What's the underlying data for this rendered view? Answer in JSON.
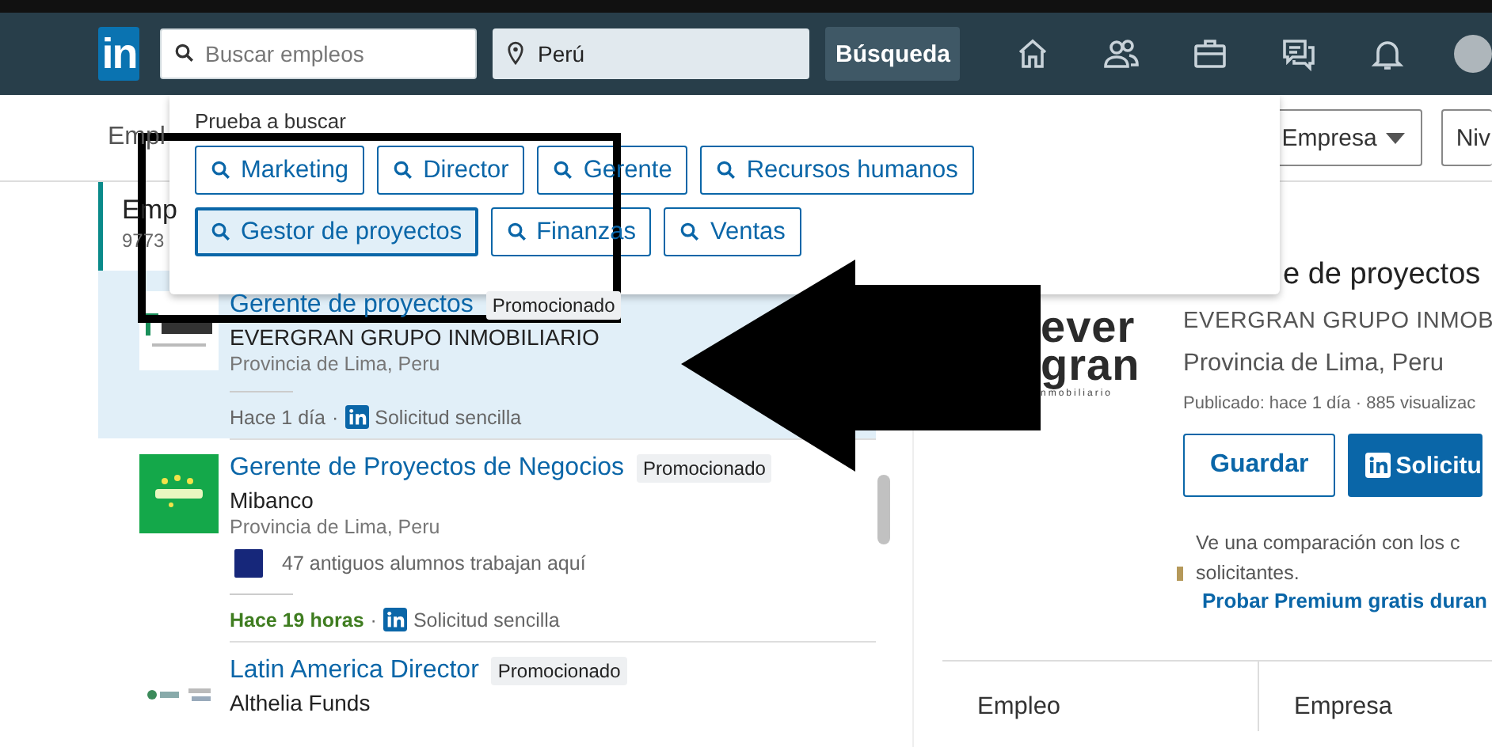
{
  "nav": {
    "logo": "in",
    "search": {
      "placeholder": "Buscar empleos"
    },
    "location": {
      "value": "Perú"
    },
    "search_button": "Búsqueda"
  },
  "filters": {
    "label": "Empl",
    "buttons": [
      {
        "label": "Empresa",
        "dropdown": true
      },
      {
        "label": "Niv",
        "dropdown": false
      }
    ]
  },
  "suggestions": {
    "heading": "Prueba a buscar",
    "chips": [
      {
        "label": "Marketing",
        "selected": false
      },
      {
        "label": "Director",
        "selected": false
      },
      {
        "label": "Gerente",
        "selected": false
      },
      {
        "label": "Recursos humanos",
        "selected": false
      },
      {
        "label": "Gestor de proyectos",
        "selected": true
      },
      {
        "label": "Finanzas",
        "selected": false
      },
      {
        "label": "Ventas",
        "selected": false
      }
    ]
  },
  "results": {
    "header": {
      "title": "Emp",
      "count": "9773"
    },
    "jobs": [
      {
        "logo": {
          "kind": "evergran"
        },
        "title": "Gerente de proyectos",
        "badge": "Promocionado",
        "company": "EVERGRAN GRUPO INMOBILIARIO",
        "location": "Provincia de Lima, Peru",
        "posted": "Hace 1 día",
        "recent": false,
        "separator": "·",
        "apply": "Solicitud sencilla",
        "selected": true
      },
      {
        "logo": {
          "kind": "mibanco"
        },
        "title": "Gerente de Proyectos de Negocios",
        "badge": "Promocionado",
        "company": "Mibanco",
        "location": "Provincia de Lima, Peru",
        "alumni": "47 antiguos alumnos trabajan aquí",
        "posted": "Hace 19 horas",
        "recent": true,
        "separator": "·",
        "apply": "Solicitud sencilla",
        "selected": false
      },
      {
        "logo": {
          "kind": "althelia"
        },
        "title": "Latin America Director",
        "badge": "Promocionado",
        "company": "Althelia Funds",
        "selected": false
      }
    ]
  },
  "detail": {
    "title": "e de proyectos",
    "logo_lines": [
      "ever",
      "gran",
      "nmobiliario"
    ],
    "company": "EVERGRAN GRUPO INMOB",
    "location": "Provincia de Lima, Peru",
    "published": "Publicado: hace 1 día · 885 visualizac",
    "buttons": [
      {
        "label": "Guardar",
        "kind": "outline"
      },
      {
        "label": "Solicitu",
        "kind": "primary"
      }
    ],
    "premium": {
      "text": "Ve una comparación con los c solicitantes.",
      "link": "Probar Premium gratis duran"
    },
    "tabs": [
      "Empleo",
      "Empresa"
    ]
  }
}
